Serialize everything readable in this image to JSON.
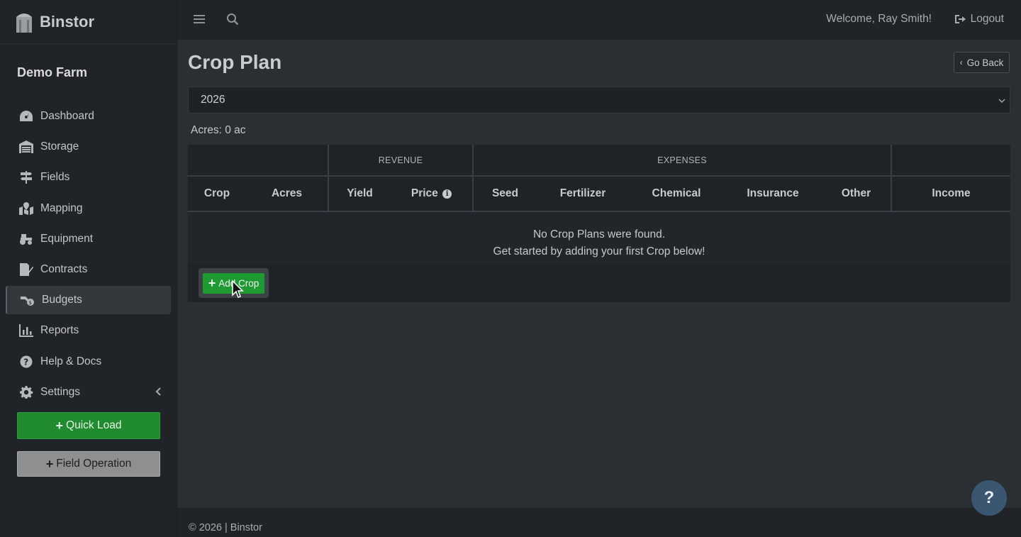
{
  "app": {
    "brand": "Binstor",
    "farm_name": "Demo Farm"
  },
  "sidebar": {
    "items": [
      {
        "label": "Dashboard",
        "icon": "dashboard-icon"
      },
      {
        "label": "Storage",
        "icon": "warehouse-icon"
      },
      {
        "label": "Fields",
        "icon": "signpost-icon"
      },
      {
        "label": "Mapping",
        "icon": "map-marked-icon"
      },
      {
        "label": "Equipment",
        "icon": "tractor-icon"
      },
      {
        "label": "Contracts",
        "icon": "file-signature-icon"
      },
      {
        "label": "Budgets",
        "icon": "hand-holding-dollar-icon",
        "active": true
      },
      {
        "label": "Reports",
        "icon": "bar-chart-icon"
      },
      {
        "label": "Help & Docs",
        "icon": "question-circle-icon"
      },
      {
        "label": "Settings",
        "icon": "gear-icon"
      }
    ],
    "quick_load": "Quick Load",
    "field_operation": "Field Operation"
  },
  "topbar": {
    "welcome": "Welcome, Ray Smith!",
    "logout": "Logout"
  },
  "page": {
    "title": "Crop Plan",
    "go_back": "Go Back",
    "year_selected": "2026",
    "acres_summary": "Acres: 0 ac"
  },
  "table": {
    "groups": {
      "revenue": "REVENUE",
      "expenses": "EXPENSES"
    },
    "columns": [
      "Crop",
      "Acres",
      "Yield",
      "Price",
      "Seed",
      "Fertilizer",
      "Chemical",
      "Insurance",
      "Other",
      "Income"
    ],
    "empty_line1": "No Crop Plans were found.",
    "empty_line2": "Get started by adding your first Crop below!",
    "add_button": "Add Crop"
  },
  "footer": {
    "text": "© 2026 | Binstor"
  },
  "help_fab": "?",
  "colors": {
    "accent_green": "#1f8a2e",
    "help_blue": "#3b5671"
  }
}
